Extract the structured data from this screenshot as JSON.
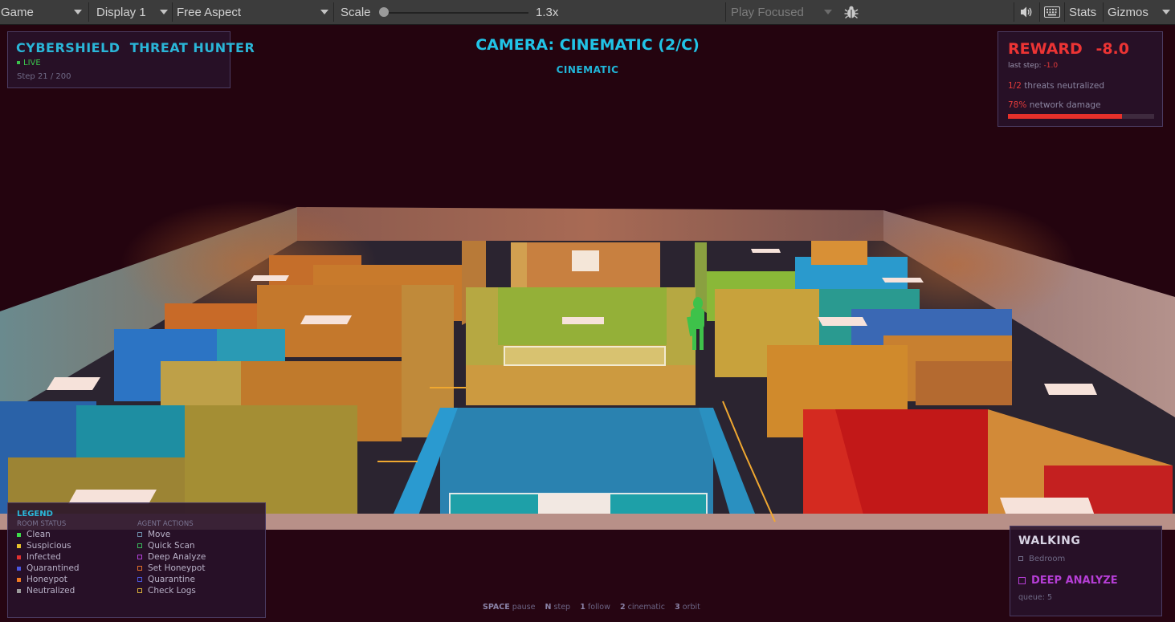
{
  "toolbar": {
    "view_label": "Game",
    "display": "Display 1",
    "aspect": "Free Aspect",
    "scale_label": "Scale",
    "scale_value": "1.3x",
    "scale_fraction": 0.0,
    "play_mode": "Play Focused",
    "stats_label": "Stats",
    "gizmos_label": "Gizmos",
    "icons": [
      "bug-icon",
      "speaker-icon",
      "keyboard-icon"
    ]
  },
  "hud": {
    "title": "CYBERSHIELD  THREAT HUNTER",
    "live": "LIVE",
    "step": "Step 21 / 200"
  },
  "camera": {
    "title": "CAMERA: CINEMATIC (2/C)",
    "mode": "CINEMATIC"
  },
  "reward": {
    "label": "REWARD",
    "value": "-8.0",
    "last_step_label": "last step:",
    "last_step_value": "-1.0",
    "threats_count": "1/2",
    "threats_label": "threats neutralized",
    "damage_pct": "78%",
    "damage_label": "network damage",
    "damage_fraction": 0.78
  },
  "legend": {
    "title": "LEGEND",
    "room_status_title": "ROOM STATUS",
    "agent_actions_title": "AGENT ACTIONS",
    "room_status": [
      {
        "label": "Clean",
        "color": "#3ddc4a"
      },
      {
        "label": "Suspicious",
        "color": "#e8c22c"
      },
      {
        "label": "Infected",
        "color": "#e23030"
      },
      {
        "label": "Quarantined",
        "color": "#4a55e0"
      },
      {
        "label": "Honeypot",
        "color": "#f07a22"
      },
      {
        "label": "Neutralized",
        "color": "#9a9a9a"
      }
    ],
    "agent_actions": [
      {
        "label": "Move",
        "color": "#6a8aa6"
      },
      {
        "label": "Quick Scan",
        "color": "#38b85a"
      },
      {
        "label": "Deep Analyze",
        "color": "#b040d8"
      },
      {
        "label": "Set Honeypot",
        "color": "#e06e2a"
      },
      {
        "label": "Quarantine",
        "color": "#4a55d8"
      },
      {
        "label": "Check Logs",
        "color": "#d8b03a"
      }
    ]
  },
  "agent": {
    "state": "WALKING",
    "location": "Bedroom",
    "action": "DEEP ANALYZE",
    "action_color": "#b63ed6",
    "queue": "queue: 5"
  },
  "help": [
    {
      "key": "SPACE",
      "label": "pause"
    },
    {
      "key": "N",
      "label": "step"
    },
    {
      "key": "1",
      "label": "follow"
    },
    {
      "key": "2",
      "label": "cinematic"
    },
    {
      "key": "3",
      "label": "orbit"
    }
  ]
}
